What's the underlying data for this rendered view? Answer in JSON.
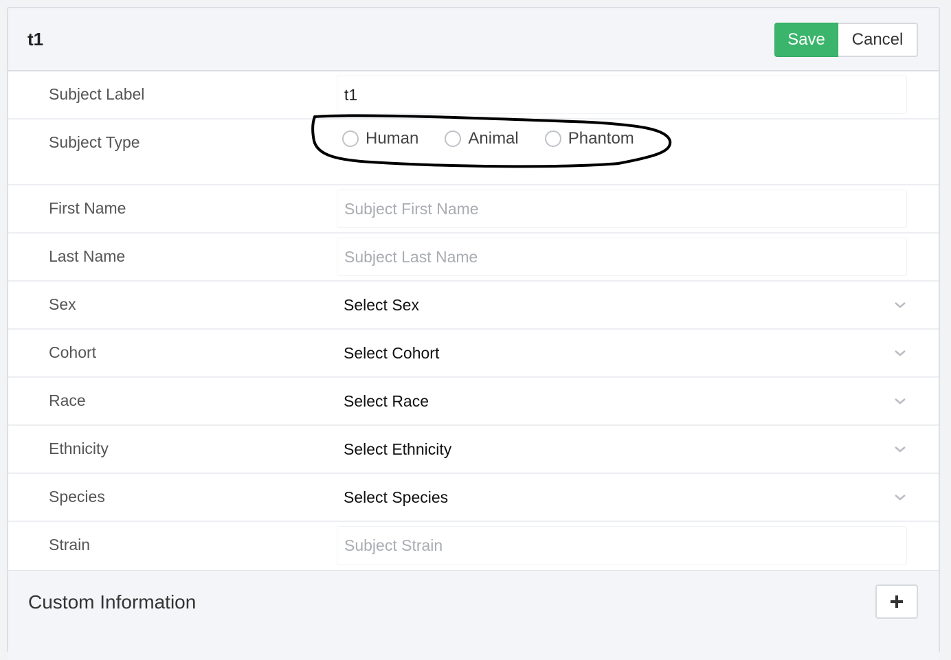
{
  "header": {
    "title": "t1",
    "save_label": "Save",
    "cancel_label": "Cancel"
  },
  "form": {
    "subject_label": {
      "label": "Subject Label",
      "value": "t1"
    },
    "subject_type": {
      "label": "Subject Type",
      "options": [
        "Human",
        "Animal",
        "Phantom"
      ]
    },
    "first_name": {
      "label": "First Name",
      "placeholder": "Subject First Name"
    },
    "last_name": {
      "label": "Last Name",
      "placeholder": "Subject Last Name"
    },
    "sex": {
      "label": "Sex",
      "selected": "Select Sex"
    },
    "cohort": {
      "label": "Cohort",
      "selected": "Select Cohort"
    },
    "race": {
      "label": "Race",
      "selected": "Select Race"
    },
    "ethnicity": {
      "label": "Ethnicity",
      "selected": "Select Ethnicity"
    },
    "species": {
      "label": "Species",
      "selected": "Select Species"
    },
    "strain": {
      "label": "Strain",
      "placeholder": "Subject Strain"
    }
  },
  "custom": {
    "title": "Custom Information"
  },
  "colors": {
    "save_green": "#3bb56b",
    "header_bg": "#f3f5f8",
    "annotation_ink": "#000000"
  }
}
